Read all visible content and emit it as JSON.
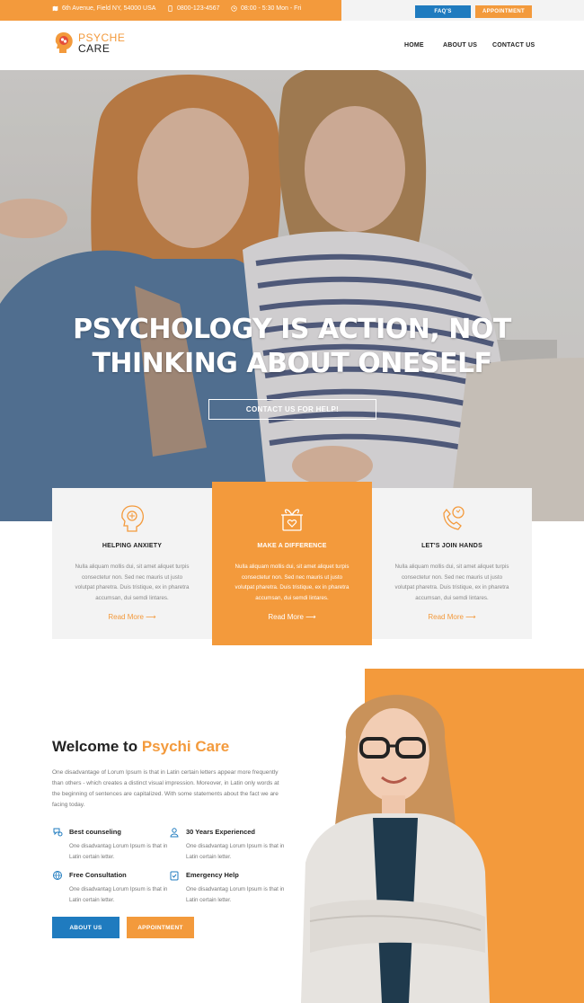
{
  "topbar": {
    "address": "6th Avenue, Field NY, 54000 USA",
    "phone": "0800-123-4567",
    "hours": "08:00 - 5:30 Mon - Fri",
    "faq_label": "FAQ'S",
    "appointment_label": "APPOINTMENT"
  },
  "header": {
    "logo_line1": "PSYCHE",
    "logo_line2": "CARE",
    "nav": [
      "HOME",
      "ABOUT US",
      "CONTACT US"
    ]
  },
  "hero": {
    "title_line1": "PSYCHOLOGY IS ACTION, NOT",
    "title_line2": "THINKING ABOUT ONESELF",
    "cta": "CONTACT US FOR HELP!"
  },
  "cards": [
    {
      "title": "HELPING ANXIETY",
      "text": "Nulla aliquam mollis dui, sit amet aliquet turpis consectetur non. Sed nec mauris ut justo volutpat pharetra. Duis tristique, ex in pharetra accumsan, dui semdi lintares.",
      "more": "Read More"
    },
    {
      "title": "MAKE A DIFFERENCE",
      "text": "Nulla aliquam mollis dui, sit amet aliquet turpis consectetur non. Sed nec mauris ut justo volutpat pharetra. Duis tristique, ex in pharetra accumsan, dui semdi lintares.",
      "more": "Read More"
    },
    {
      "title": "LET'S JOIN HANDS",
      "text": "Nulla aliquam mollis dui, sit amet aliquet turpis consectetur non. Sed nec mauris ut justo volutpat pharetra. Duis tristique, ex in pharetra accumsan, dui semdi lintares.",
      "more": "Read More"
    }
  ],
  "welcome": {
    "title_prefix": "Welcome to",
    "title_accent": "Psychi Care",
    "text": "One disadvantage of Lorum Ipsum is that in Latin certain letters appear more frequently than others - which creates a distinct visual impression. Moreover, in Latin only words at the beginning of sentences are capitalized. With some statements about the fact we are facing today.",
    "features": [
      {
        "title": "Best counseling",
        "text": "One disadvantag Lorum Ipsum is that in Latin certain letter."
      },
      {
        "title": "30 Years Experienced",
        "text": "One disadvantag Lorum Ipsum is that in Latin certain letter."
      },
      {
        "title": "Free Consultation",
        "text": "One disadvantag Lorum Ipsum is that in Latin certain letter."
      },
      {
        "title": "Emergency Help",
        "text": "One disadvantag Lorum Ipsum is that in Latin certain letter."
      }
    ],
    "about_label": "ABOUT US",
    "appointment_label": "APPOINTMENT"
  },
  "colors": {
    "accent": "#f39a3c",
    "blue": "#1f7bbf"
  }
}
